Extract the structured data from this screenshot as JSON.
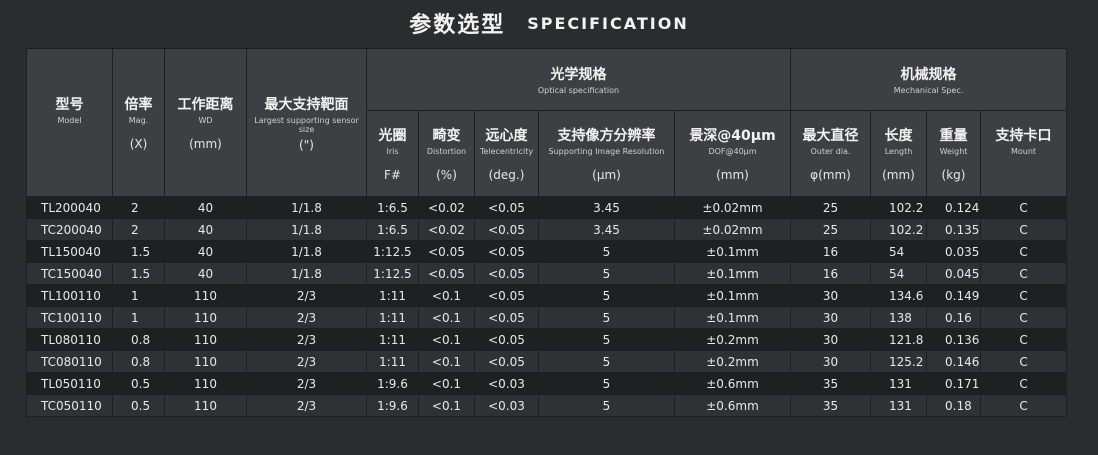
{
  "title": {
    "cn": "参数选型",
    "en": "SPECIFICATION"
  },
  "groups": {
    "optical": {
      "cn": "光学规格",
      "en": "Optical specification"
    },
    "mechanical": {
      "cn": "机械规格",
      "en": "Mechanical Spec."
    }
  },
  "columns": [
    {
      "cn": "型号",
      "en": "Model",
      "unit": ""
    },
    {
      "cn": "倍率",
      "en": "Mag.",
      "unit": "(X)"
    },
    {
      "cn": "工作距离",
      "en": "WD",
      "unit": "(mm)"
    },
    {
      "cn": "最大支持靶面",
      "en": "Largest supporting sensor size",
      "unit": "(\")"
    },
    {
      "cn": "光圈",
      "en": "Iris",
      "unit": "F#"
    },
    {
      "cn": "畸变",
      "en": "Distortion",
      "unit": "(%)"
    },
    {
      "cn": "远心度",
      "en": "Telecentricity",
      "unit": "(deg.)"
    },
    {
      "cn": "支持像方分辨率",
      "en": "Supporting Image Resolution",
      "unit": "(μm)"
    },
    {
      "cn": "景深@40μm",
      "en": "DOF@40μm",
      "unit": "(mm)"
    },
    {
      "cn": "最大直径",
      "en": "Outer dia.",
      "unit": "φ(mm)"
    },
    {
      "cn": "长度",
      "en": "Length",
      "unit": "(mm)"
    },
    {
      "cn": "重量",
      "en": "Weight",
      "unit": "(kg)"
    },
    {
      "cn": "支持卡口",
      "en": "Mount",
      "unit": ""
    }
  ],
  "rows": [
    [
      "TL200040",
      "2",
      "40",
      "1/1.8",
      "1:6.5",
      "<0.02",
      "<0.05",
      "3.45",
      "±0.02mm",
      "25",
      "102.2",
      "0.124",
      "C"
    ],
    [
      "TC200040",
      "2",
      "40",
      "1/1.8",
      "1:6.5",
      "<0.02",
      "<0.05",
      "3.45",
      "±0.02mm",
      "25",
      "102.2",
      "0.135",
      "C"
    ],
    [
      "TL150040",
      "1.5",
      "40",
      "1/1.8",
      "1:12.5",
      "<0.05",
      "<0.05",
      "5",
      "±0.1mm",
      "16",
      "54",
      "0.035",
      "C"
    ],
    [
      "TC150040",
      "1.5",
      "40",
      "1/1.8",
      "1:12.5",
      "<0.05",
      "<0.05",
      "5",
      "±0.1mm",
      "16",
      "54",
      "0.045",
      "C"
    ],
    [
      "TL100110",
      "1",
      "110",
      "2/3",
      "1:11",
      "<0.1",
      "<0.05",
      "5",
      "±0.1mm",
      "30",
      "134.6",
      "0.149",
      "C"
    ],
    [
      "TC100110",
      "1",
      "110",
      "2/3",
      "1:11",
      "<0.1",
      "<0.05",
      "5",
      "±0.1mm",
      "30",
      "138",
      "0.16",
      "C"
    ],
    [
      "TL080110",
      "0.8",
      "110",
      "2/3",
      "1:11",
      "<0.1",
      "<0.05",
      "5",
      "±0.2mm",
      "30",
      "121.8",
      "0.136",
      "C"
    ],
    [
      "TC080110",
      "0.8",
      "110",
      "2/3",
      "1:11",
      "<0.1",
      "<0.05",
      "5",
      "±0.2mm",
      "30",
      "125.2",
      "0.146",
      "C"
    ],
    [
      "TL050110",
      "0.5",
      "110",
      "2/3",
      "1:9.6",
      "<0.1",
      "<0.03",
      "5",
      "±0.6mm",
      "35",
      "131",
      "0.171",
      "C"
    ],
    [
      "TC050110",
      "0.5",
      "110",
      "2/3",
      "1:9.6",
      "<0.1",
      "<0.03",
      "5",
      "±0.6mm",
      "35",
      "131",
      "0.18",
      "C"
    ]
  ]
}
